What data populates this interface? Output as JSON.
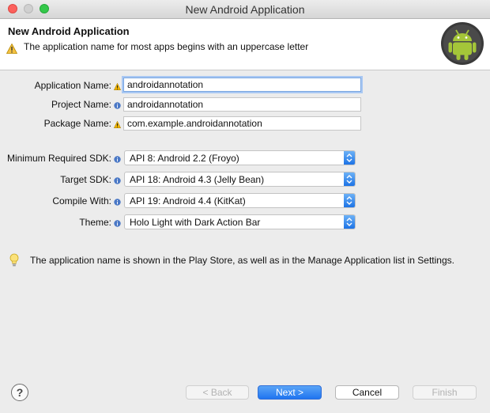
{
  "window": {
    "title": "New Android Application"
  },
  "header": {
    "title": "New Android Application",
    "message": "The application name for most apps begins with an uppercase letter"
  },
  "fields": {
    "application_name": {
      "label": "Application Name:",
      "value": "androidannotation",
      "marker": "warning-icon"
    },
    "project_name": {
      "label": "Project Name:",
      "value": "androidannotation",
      "marker": "info-icon"
    },
    "package_name": {
      "label": "Package Name:",
      "value": "com.example.androidannotation",
      "marker": "warning-icon"
    }
  },
  "selects": {
    "min_sdk": {
      "label": "Minimum Required SDK:",
      "value": "API 8: Android 2.2 (Froyo)"
    },
    "target_sdk": {
      "label": "Target SDK:",
      "value": "API 18: Android 4.3 (Jelly Bean)"
    },
    "compile_with": {
      "label": "Compile With:",
      "value": "API 19: Android 4.4 (KitKat)"
    },
    "theme": {
      "label": "Theme:",
      "value": "Holo Light with Dark Action Bar"
    }
  },
  "info": {
    "message": "The application name is shown in the Play Store, as well as in the Manage Application list in Settings.",
    "icon": "lightbulb-icon"
  },
  "buttons": {
    "help": "?",
    "back": "< Back",
    "next": "Next >",
    "cancel": "Cancel",
    "finish": "Finish"
  },
  "colors": {
    "accent": "#1f74f0",
    "android_green": "#a4c639",
    "warning": "#f0b400"
  }
}
